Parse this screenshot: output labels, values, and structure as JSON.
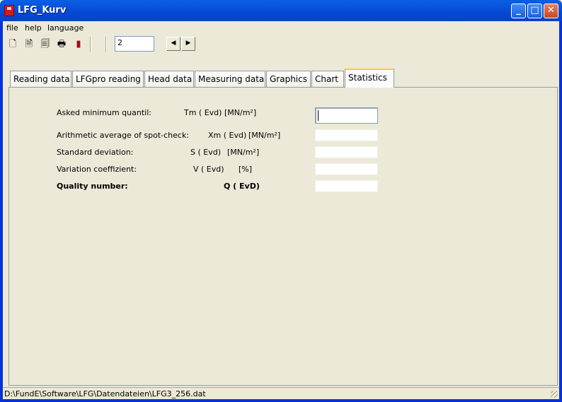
{
  "window": {
    "title": "LFG_Kurv"
  },
  "menu": {
    "items": [
      "file",
      "help",
      "language"
    ]
  },
  "toolbar": {
    "record_value": "2"
  },
  "tabs": [
    "Reading data",
    "LFGpro reading",
    "Head data",
    "Measuring data",
    "Graphics",
    "Chart",
    "Statistics"
  ],
  "active_tab": "Statistics",
  "statistics": {
    "rows": [
      {
        "label": "Asked minimum quantil:",
        "symbol": "Tm ( Evd)",
        "unit": "[MN/m²]",
        "value": ""
      },
      {
        "label": "Arithmetic average of spot-check:",
        "symbol": "Xm ( Evd)",
        "unit": "[MN/m²]",
        "value": ""
      },
      {
        "label": "Standard deviation:",
        "symbol": "S ( Evd)",
        "unit": "[MN/m²]",
        "value": ""
      },
      {
        "label": "Variation coeffizient:",
        "symbol": "V ( Evd)",
        "unit": "[%]",
        "value": ""
      },
      {
        "label": "Quality number:",
        "symbol": "Q ( EvD)",
        "unit": "",
        "value": ""
      }
    ]
  },
  "statusbar": {
    "path": "D:\\FundE\\Software\\LFG\\Datendateien\\LFG3_256.dat"
  }
}
